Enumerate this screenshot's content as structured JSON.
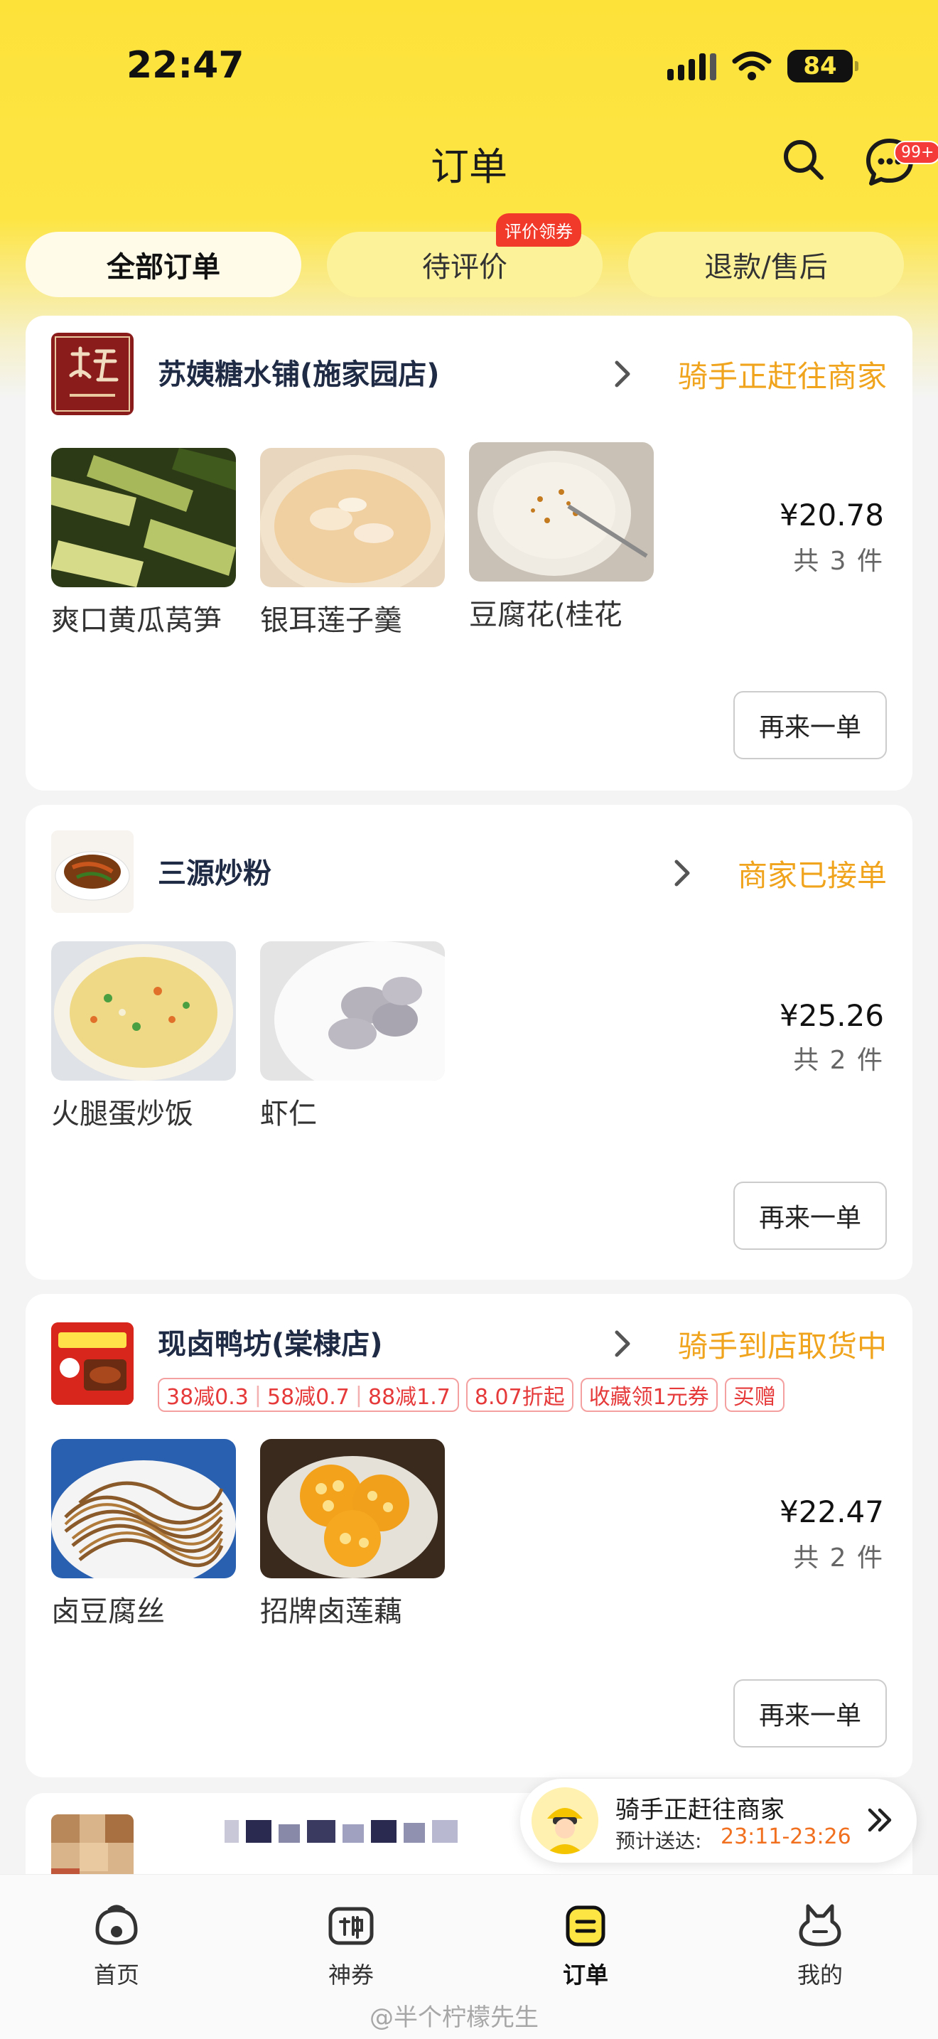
{
  "status_bar": {
    "time": "22:47",
    "battery": "84"
  },
  "nav": {
    "title": "订单",
    "message_badge": "99+"
  },
  "tabs": [
    {
      "label": "全部订单",
      "active": true
    },
    {
      "label": "待评价",
      "active": false,
      "badge": "评价领券"
    },
    {
      "label": "退款/售后",
      "active": false
    }
  ],
  "orders": [
    {
      "shop": "苏姨糖水铺(施家园店)",
      "status": "骑手正赶往商家",
      "items": [
        {
          "name": "爽口黄瓜莴笋"
        },
        {
          "name": "银耳莲子羹"
        },
        {
          "name": "豆腐花(桂花"
        }
      ],
      "price": "¥20.78",
      "count": "共 3 件",
      "reorder": "再来一单"
    },
    {
      "shop": "三源炒粉",
      "status": "商家已接单",
      "items": [
        {
          "name": "火腿蛋炒饭"
        },
        {
          "name": "虾仁"
        }
      ],
      "price": "¥25.26",
      "count": "共 2 件",
      "reorder": "再来一单"
    },
    {
      "shop": "现卤鸭坊(棠棣店)",
      "status": "骑手到店取货中",
      "promos": [
        "38减0.3",
        "58减0.7",
        "88减1.7",
        "8.07折起",
        "收藏领1元券",
        "买赠"
      ],
      "items": [
        {
          "name": "卤豆腐丝"
        },
        {
          "name": "招牌卤莲藕"
        }
      ],
      "price": "¥22.47",
      "count": "共 2 件",
      "reorder": "再来一单"
    }
  ],
  "rider_pill": {
    "title": "骑手正赶往商家",
    "eta_label": "预计送达:",
    "eta": "23:11-23:26"
  },
  "tabbar": [
    {
      "label": "首页",
      "icon": "home-icon"
    },
    {
      "label": "神券",
      "icon": "coupon-icon"
    },
    {
      "label": "订单",
      "icon": "order-icon",
      "active": true
    },
    {
      "label": "我的",
      "icon": "profile-icon"
    }
  ],
  "watermark": "@半个柠檬先生",
  "colors": {
    "brand_yellow": "#fde544",
    "status_orange": "#f0a41e",
    "promo_red": "#e5393a"
  }
}
